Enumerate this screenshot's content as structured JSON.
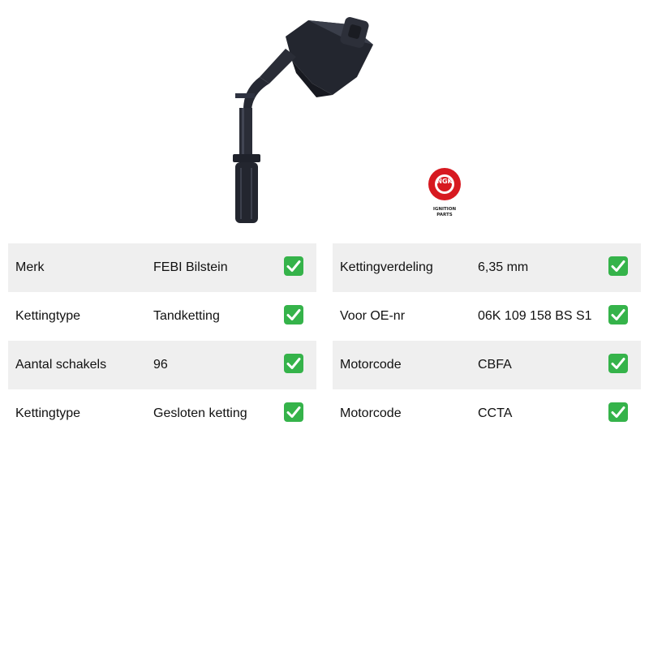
{
  "product": {
    "image_icon": "ignition-coil-image",
    "logo_icon": "ngk-logo",
    "logo_text_brand": "NGK",
    "logo_text_line1": "IGNITION",
    "logo_text_line2": "PARTS",
    "logo_color": "#d71920"
  },
  "check_icon": "check-mark-icon",
  "check_color": "#35b34a",
  "spec_left": [
    {
      "label": "Merk",
      "value": "FEBI Bilstein"
    },
    {
      "label": "Kettingtype",
      "value": "Tandketting"
    },
    {
      "label": "Aantal schakels",
      "value": "96"
    },
    {
      "label": "Kettingtype",
      "value": "Gesloten ketting"
    }
  ],
  "spec_right": [
    {
      "label": "Kettingverdeling",
      "value": "6,35 mm"
    },
    {
      "label": "Voor OE-nr",
      "value": "06K 109 158 BS S1"
    },
    {
      "label": "Motorcode",
      "value": "CBFA"
    },
    {
      "label": "Motorcode",
      "value": "CCTA"
    }
  ]
}
